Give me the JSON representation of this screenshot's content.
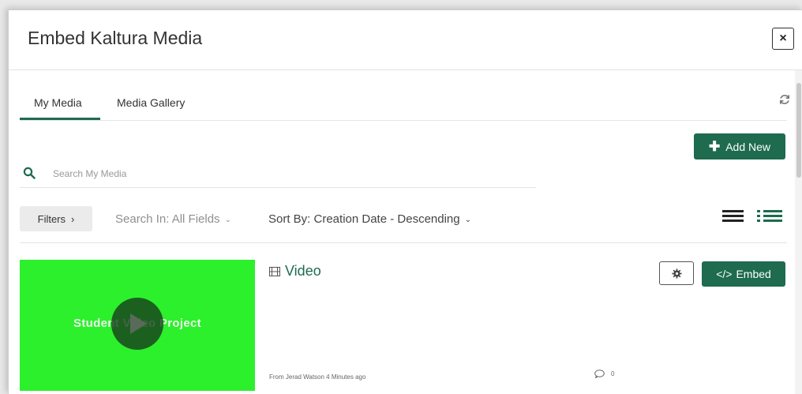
{
  "dialog": {
    "title": "Embed Kaltura Media",
    "close_label": "×"
  },
  "tabs": [
    {
      "label": "My Media",
      "active": true
    },
    {
      "label": "Media Gallery",
      "active": false
    }
  ],
  "toolbar": {
    "add_new_label": "Add New",
    "add_new_icon": "plus-icon"
  },
  "search": {
    "placeholder": "Search My Media",
    "value": ""
  },
  "filters": {
    "filters_label": "Filters",
    "search_in_label": "Search In: All Fields",
    "sort_by_label": "Sort By: Creation Date - Descending"
  },
  "entries": [
    {
      "title": "Video",
      "thumbnail_text": "Student Video Project",
      "meta": "From Jerad Watson 4 Minutes ago",
      "comments": "0",
      "embed_label": "Embed",
      "embed_icon_text": "</>",
      "type_icon": "film-icon"
    }
  ],
  "colors": {
    "accent": "#1e6b4f",
    "thumbnail": "#2cf02b"
  }
}
